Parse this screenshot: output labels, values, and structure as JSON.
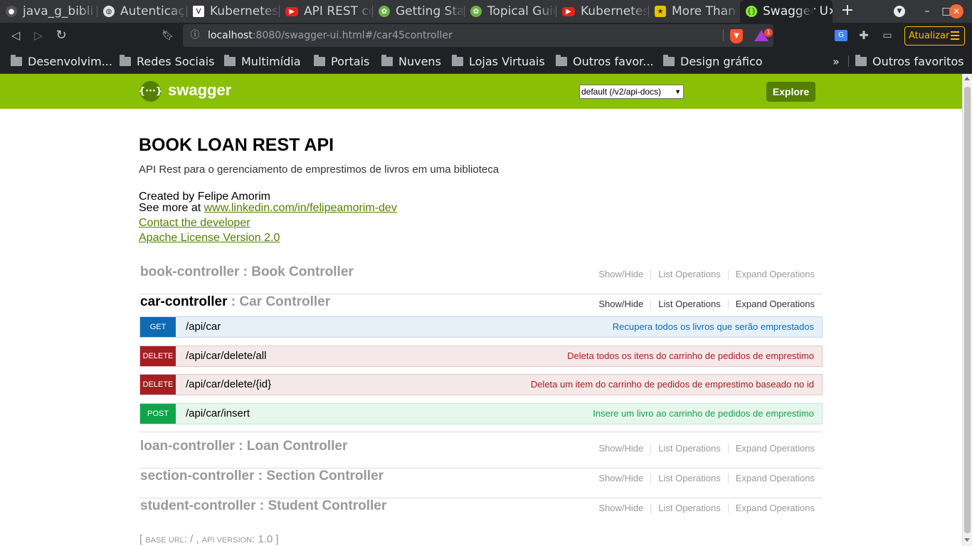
{
  "browser": {
    "tabs": [
      {
        "title": "java_g_bibli",
        "icon": "github-icon"
      },
      {
        "title": "Autenticaçã",
        "icon": "globe-icon"
      },
      {
        "title": "Kubernetes",
        "icon": "v-icon"
      },
      {
        "title": "API REST co",
        "icon": "youtube-icon"
      },
      {
        "title": "Getting Star",
        "icon": "spring-icon"
      },
      {
        "title": "Topical Guid",
        "icon": "spring-icon"
      },
      {
        "title": "Kubernetes",
        "icon": "youtube-icon"
      },
      {
        "title": "More Than V",
        "icon": "star-icon"
      },
      {
        "title": "Swagger U",
        "icon": "swagger-icon",
        "active": true
      }
    ],
    "new_tab": "+",
    "url_host": "localhost",
    "url_rest": ":8080/swagger-ui.html#/car45controller",
    "update_button": "Atualizar",
    "shield_badge": "1",
    "bookmarks": [
      "Desenvolvim...",
      "Redes Sociais",
      "Multimídia",
      "Portais",
      "Nuvens",
      "Lojas Virtuais",
      "Outros favor...",
      "Design gráfico"
    ],
    "bookmarks_overflow": "»",
    "other_bookmarks": "Outros favoritos"
  },
  "swagger": {
    "logo_symbol": "{···}",
    "logo_text": "swagger",
    "api_select": "default (/v2/api-docs)",
    "explore_label": "Explore"
  },
  "info": {
    "title": "BOOK LOAN REST API",
    "description": "API Rest para o gerenciamento de emprestimos de livros em uma biblioteca",
    "created_by": "Created by Felipe Amorim",
    "see_more_prefix": "See more at ",
    "see_more_link": "www.linkedin.com/in/felipeamorim-dev",
    "contact": "Contact the developer",
    "license": "Apache License Version 2.0"
  },
  "ops_labels": {
    "show_hide": "Show/Hide",
    "list": "List Operations",
    "expand": "Expand Operations"
  },
  "resources": [
    {
      "name": "book-controller",
      "desc": " : Book Controller"
    },
    {
      "name": "car-controller",
      "desc": " : Car Controller"
    },
    {
      "name": "loan-controller",
      "desc": " : Loan Controller"
    },
    {
      "name": "section-controller",
      "desc": " : Section Controller"
    },
    {
      "name": "student-controller",
      "desc": " : Student Controller"
    }
  ],
  "endpoints": [
    {
      "method": "GET",
      "path": "/api/car",
      "summary": "Recupera todos os livros que serão emprestados"
    },
    {
      "method": "DELETE",
      "path": "/api/car/delete/all",
      "summary": "Deleta todos os itens do carrinho de pedidos de emprestimo"
    },
    {
      "method": "DELETE",
      "path": "/api/car/delete/{id}",
      "summary": "Deleta um item do carrinho de pedidos de emprestimo baseado no id"
    },
    {
      "method": "POST",
      "path": "/api/car/insert",
      "summary": "Insere um livro ao carrinho de pedidos de emprestimo"
    }
  ],
  "footer": {
    "open": "[ ",
    "base_url_label": "base url",
    "base_url_value": ": / , ",
    "api_version_label": "api version",
    "api_version_value": ": 1.0 ]"
  },
  "colors": {
    "swagger_green": "#89bf04",
    "get": "#0f6ab4",
    "delete": "#a41e22",
    "post": "#10a54a"
  }
}
